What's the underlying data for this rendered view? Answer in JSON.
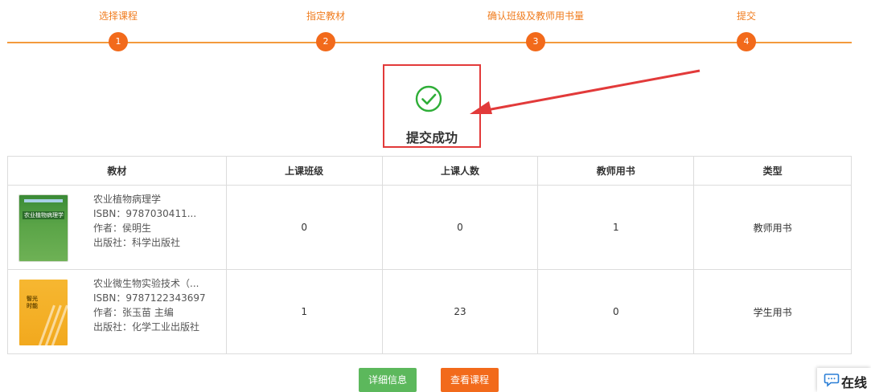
{
  "stepper": {
    "steps": [
      {
        "label": "选择课程",
        "number": "1"
      },
      {
        "label": "指定教材",
        "number": "2"
      },
      {
        "label": "确认班级及教师用书量",
        "number": "3"
      },
      {
        "label": "提交",
        "number": "4"
      }
    ]
  },
  "success": {
    "message": "提交成功",
    "icon": "check-circle-icon"
  },
  "table": {
    "headers": [
      "教材",
      "上课班级",
      "上课人数",
      "教师用书",
      "类型"
    ],
    "rows": [
      {
        "cover_text": "农业植物病理学",
        "title": "农业植物病理学",
        "isbn": "ISBN：9787030411...",
        "author": "作者：侯明生",
        "publisher": "出版社：科学出版社",
        "class_count": "0",
        "students": "0",
        "teacher_books": "1",
        "type": "教师用书"
      },
      {
        "cover_text": "智光\n时能",
        "title": "农业微生物实验技术（...",
        "isbn": "ISBN：9787122343697",
        "author": "作者：张玉苗 主编",
        "publisher": "出版社：化学工业出版社",
        "class_count": "1",
        "students": "23",
        "teacher_books": "0",
        "type": "学生用书"
      }
    ]
  },
  "buttons": {
    "detail": "详细信息",
    "view_course": "查看课程"
  },
  "chat": {
    "label": "在线",
    "icon": "chat-bubble-icon"
  },
  "colors": {
    "accent": "#f26a1b",
    "step_line": "#f39a3c",
    "success_green": "#2fae38",
    "highlight_red": "#e23a3a",
    "detail_button": "#5cb85c"
  }
}
